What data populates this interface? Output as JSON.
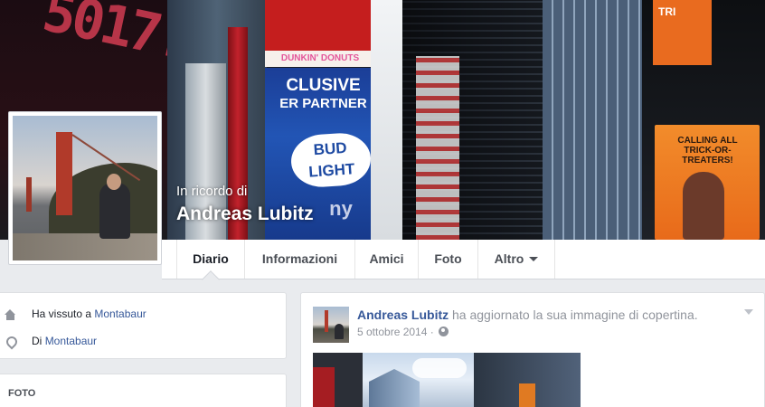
{
  "profile": {
    "memorial_label": "In ricordo di",
    "name": "Andreas Lubitz"
  },
  "cover": {
    "sign_dunkin": "DUNKIN' DONUTS",
    "sign_exclusive_1": "CLUSIVE",
    "sign_exclusive_2": "ER PARTNER",
    "sign_bud": "BUD LIGHT",
    "sign_ny": "ny",
    "sign_trick": "CALLING ALL TRICK-OR-TREATERS!",
    "sign_orange": "TRI"
  },
  "nav": {
    "tabs": [
      {
        "label": "Diario",
        "active": true
      },
      {
        "label": "Informazioni"
      },
      {
        "label": "Amici"
      },
      {
        "label": "Foto"
      },
      {
        "label": "Altro",
        "has_dropdown": true
      }
    ]
  },
  "about": {
    "lived": {
      "prefix": "Ha vissuto a",
      "place": "Montabaur",
      "icon": "house-icon"
    },
    "from": {
      "prefix": "Di",
      "place": "Montabaur",
      "icon": "pin-icon"
    }
  },
  "photos": {
    "heading": "FOTO"
  },
  "post": {
    "author": "Andreas Lubitz",
    "action": "ha aggiornato la sua immagine di copertina.",
    "date": "5 ottobre 2014",
    "separator": "·",
    "privacy_icon": "globe-icon"
  },
  "colors": {
    "link": "#365899",
    "page_bg": "#e9ebee",
    "muted_text": "#90949c"
  }
}
